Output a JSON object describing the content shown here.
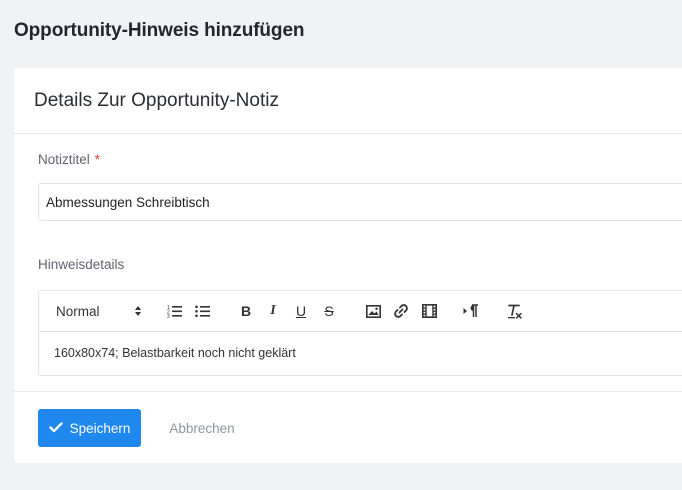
{
  "page": {
    "title": "Opportunity-Hinweis hinzufügen"
  },
  "card": {
    "title": "Details Zur Opportunity-Notiz"
  },
  "form": {
    "note_title": {
      "label": "Notiztitel",
      "required_marker": "*",
      "value": "Abmessungen Schreibtisch"
    },
    "note_details": {
      "label": "Hinweisdetails",
      "content": "160x80x74; Belastbarkeit noch nicht geklärt"
    }
  },
  "toolbar": {
    "format_value": "Normal",
    "bold_label": "B",
    "italic_label": "I",
    "underline_label": "U",
    "strike_label": "S",
    "icons": [
      "ordered-list-icon",
      "bullet-list-icon",
      "image-icon",
      "link-icon",
      "video-icon",
      "text-direction-icon",
      "clear-format-icon"
    ]
  },
  "actions": {
    "save_label": "Speichern",
    "cancel_label": "Abbrechen"
  },
  "colors": {
    "primary": "#1e88ef",
    "required": "#e0392b",
    "background": "#f1f2f6"
  }
}
